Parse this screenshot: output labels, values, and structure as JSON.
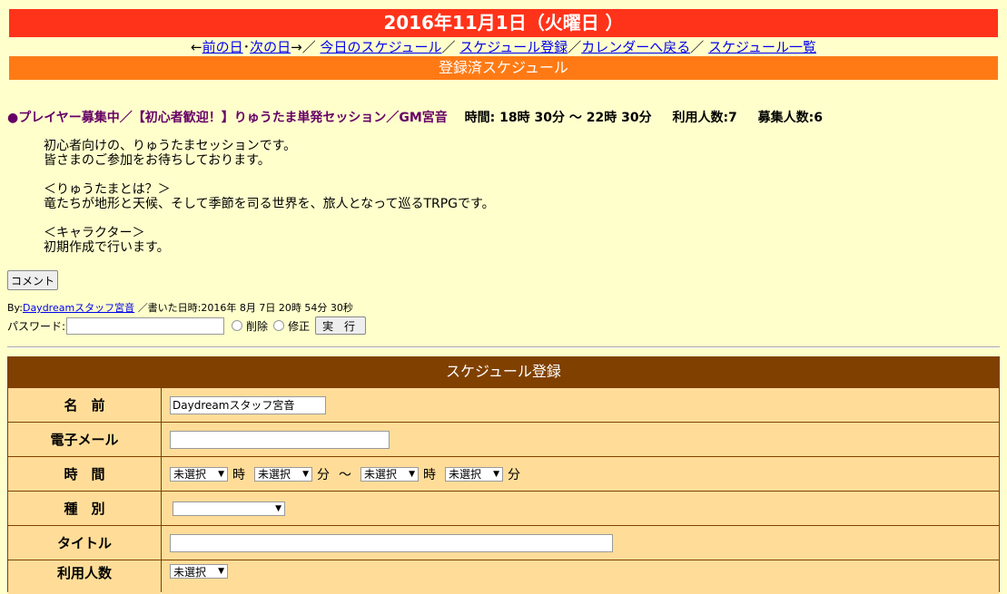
{
  "header": {
    "date": "2016年11月1日（火曜日 ）"
  },
  "nav": {
    "prev_arrow": "←",
    "prev": "前の日",
    "dot": "･",
    "next": "次の日",
    "next_arrow": "→",
    "sep": "／",
    "today": "今日のスケジュール",
    "register": "スケジュール登録",
    "calendar": "カレンダーへ戻る",
    "list": "スケジュール一覧"
  },
  "section": {
    "title": "登録済スケジュール"
  },
  "event": {
    "title": "●プレイヤー募集中／【初心者歓迎！】りゅうたま単発セッション／GM宮音",
    "time": "時間: 18時 30分 〜 22時 30分",
    "users": "利用人数:7",
    "recruit": "募集人数:6",
    "body": "初心者向けの、りゅうたまセッションです。\n皆さまのご参加をお待ちしております。\n\n＜りゅうたまとは？＞\n竜たちが地形と天候、そして季節を司る世界を、旅人となって巡るTRPGです。\n\n＜キャラクター＞\n初期作成で行います。",
    "comment_button": "コメント",
    "by_prefix": "By:",
    "author": "Daydreamスタッフ宮音",
    "written": "／書いた日時:2016年 8月 7日 20時 54分 30秒",
    "password_label": "パスワード:",
    "delete_label": "削除",
    "edit_label": "修正",
    "exec_button": "実 行"
  },
  "form": {
    "title": "スケジュール登録",
    "name_label": "名　前",
    "name_value": "Daydreamスタッフ宮音",
    "email_label": "電子メール",
    "email_value": "",
    "time_label": "時　間",
    "unselected": "未選択",
    "hour_unit": "時",
    "minute_unit": "分",
    "tilde": "〜",
    "type_label": "種　別",
    "title_label": "タイトル",
    "title_value": "",
    "users_label": "利用人数"
  }
}
